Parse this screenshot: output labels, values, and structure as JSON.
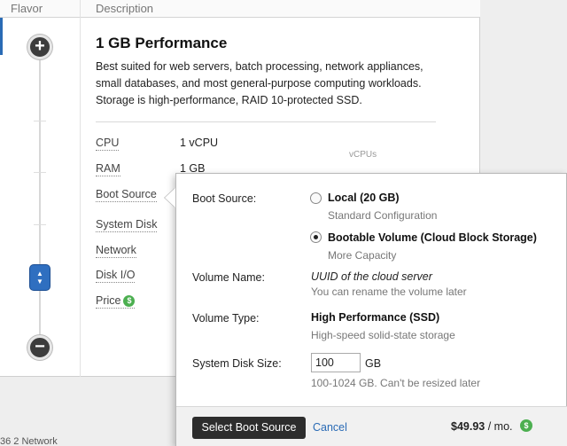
{
  "table": {
    "header_flavor": "Flavor",
    "header_description": "Description"
  },
  "slider": {
    "plus_glyph": "+",
    "minus_glyph": "−",
    "handle_glyph": "▲\n▼"
  },
  "flavor": {
    "title": "1 GB Performance",
    "description": "Best suited for web servers, batch processing, network appliances, small databases, and most general-purpose computing workloads. Storage is high-performance, RAID 10-protected SSD.",
    "specs": {
      "cpu_label": "CPU",
      "cpu_value": "1 vCPU",
      "ram_label": "RAM",
      "ram_value": "1 GB",
      "boot_source_label": "Boot Source",
      "system_disk_label": "System Disk",
      "network_label": "Network",
      "disk_io_label": "Disk I/O",
      "price_label": "Price",
      "price_icon": "$"
    },
    "vcpus_hint": "vCPUs"
  },
  "popover": {
    "boot_source_label": "Boot Source:",
    "options": [
      {
        "title": "Local (20 GB)",
        "subtitle": "Standard Configuration",
        "selected": false
      },
      {
        "title": "Bootable Volume (Cloud Block Storage)",
        "subtitle": "More Capacity",
        "selected": true
      }
    ],
    "volume_name_label": "Volume Name:",
    "volume_name_value": "UUID of the cloud server",
    "volume_name_help": "You can rename the volume later",
    "volume_type_label": "Volume Type:",
    "volume_type_value": "High Performance (SSD)",
    "volume_type_help": "High-speed solid-state storage",
    "disk_size_label": "System Disk Size:",
    "disk_size_value": "100",
    "disk_size_unit": "GB",
    "disk_size_help": "100-1024 GB. Can't be resized later",
    "select_button": "Select Boot Source",
    "cancel_link": "Cancel",
    "cost_amount": "$49.93",
    "cost_period": " / mo.",
    "cost_icon": "$"
  },
  "bottom": {
    "fragment": "36  2 Network"
  }
}
